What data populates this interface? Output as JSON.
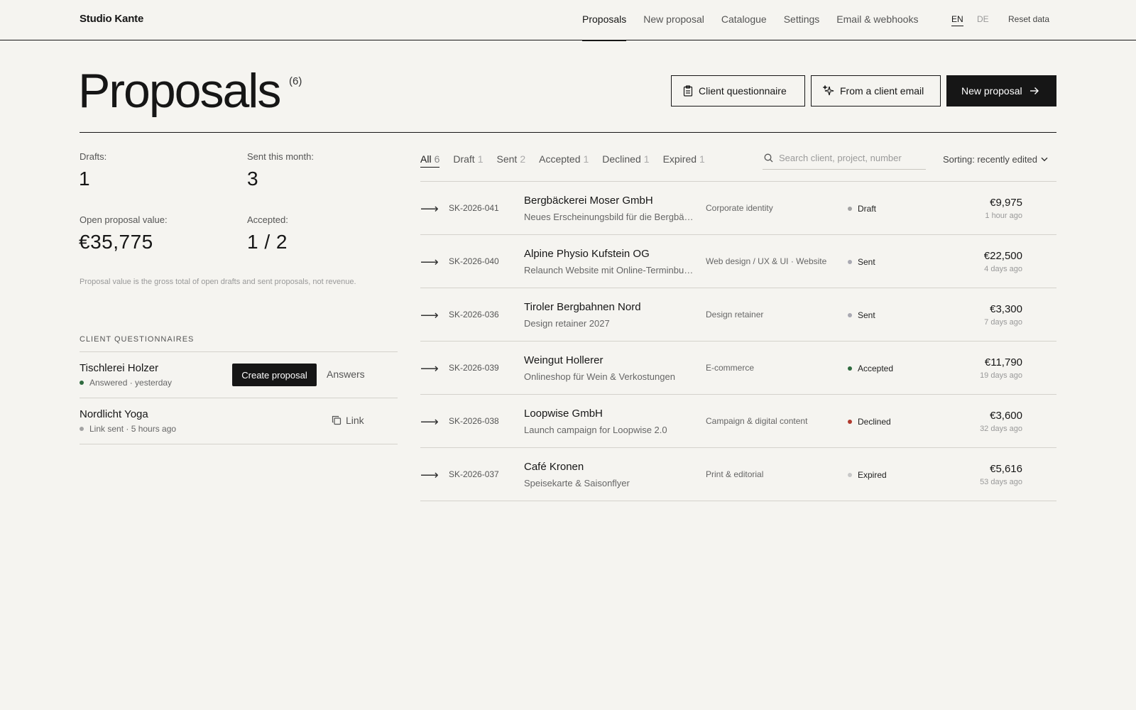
{
  "brand": "Studio Kante",
  "nav": {
    "items": [
      "Proposals",
      "New proposal",
      "Catalogue",
      "Settings",
      "Email & webhooks"
    ],
    "active": "Proposals",
    "lang_en": "EN",
    "lang_de": "DE",
    "active_lang": "EN",
    "reset": "Reset data"
  },
  "header": {
    "title": "Proposals",
    "count": "(6)",
    "btn_questionnaire": "Client questionnaire",
    "btn_email": "From a client email",
    "btn_new": "New proposal"
  },
  "stats": {
    "drafts_label": "Drafts:",
    "drafts_value": "1",
    "sent_label": "Sent this month:",
    "sent_value": "3",
    "open_label": "Open proposal value:",
    "open_value": "€35,775",
    "accepted_label": "Accepted:",
    "accepted_value": "1 / 2",
    "note": "Proposal value is the gross total of open drafts and sent proposals, not revenue."
  },
  "questionnaires": {
    "heading": "CLIENT QUESTIONNAIRES",
    "items": [
      {
        "name": "Tischlerei Holzer",
        "status": "Answered · yesterday",
        "dot_color": "#2f6b3f",
        "action": "Create proposal",
        "secondary": "Answers"
      },
      {
        "name": "Nordlicht Yoga",
        "status": "Link sent · 5 hours ago",
        "dot_color": "#a3a3a3",
        "secondary": "Link",
        "secondary_icon": "copy-icon"
      }
    ]
  },
  "filters": {
    "items": [
      {
        "label": "All",
        "count": "6"
      },
      {
        "label": "Draft",
        "count": "1"
      },
      {
        "label": "Sent",
        "count": "2"
      },
      {
        "label": "Accepted",
        "count": "1"
      },
      {
        "label": "Declined",
        "count": "1"
      },
      {
        "label": "Expired",
        "count": "1"
      }
    ],
    "active": "All",
    "search_placeholder": "Search client, project, number",
    "sort": "Sorting: recently edited"
  },
  "proposals": [
    {
      "number": "SK-2026-041",
      "client": "Bergbäckerei Moser GmbH",
      "project": "Neues Erscheinungsbild für die Bergbäckerei",
      "category": "Corporate identity",
      "status": "Draft",
      "status_color": "#a3a3a3",
      "amount": "€9,975",
      "ago": "1 hour ago"
    },
    {
      "number": "SK-2026-040",
      "client": "Alpine Physio Kufstein OG",
      "project": "Relaunch Website mit Online-Terminbuchung",
      "category": "Web design / UX & UI · Website",
      "status": "Sent",
      "status_color": "#a9a9b2",
      "amount": "€22,500",
      "ago": "4 days ago"
    },
    {
      "number": "SK-2026-036",
      "client": "Tiroler Bergbahnen Nord",
      "project": "Design retainer 2027",
      "category": "Design retainer",
      "status": "Sent",
      "status_color": "#a9a9b2",
      "amount": "€3,300",
      "ago": "7 days ago"
    },
    {
      "number": "SK-2026-039",
      "client": "Weingut Hollerer",
      "project": "Onlineshop für Wein & Verkostungen",
      "category": "E-commerce",
      "status": "Accepted",
      "status_color": "#2f6b3f",
      "amount": "€11,790",
      "ago": "19 days ago"
    },
    {
      "number": "SK-2026-038",
      "client": "Loopwise GmbH",
      "project": "Launch campaign for Loopwise 2.0",
      "category": "Campaign & digital content",
      "status": "Declined",
      "status_color": "#b03a2e",
      "amount": "€3,600",
      "ago": "32 days ago"
    },
    {
      "number": "SK-2026-037",
      "client": "Café Kronen",
      "project": "Speisekarte & Saisonflyer",
      "category": "Print & editorial",
      "status": "Expired",
      "status_color": "#c8c8c8",
      "amount": "€5,616",
      "ago": "53 days ago"
    }
  ]
}
